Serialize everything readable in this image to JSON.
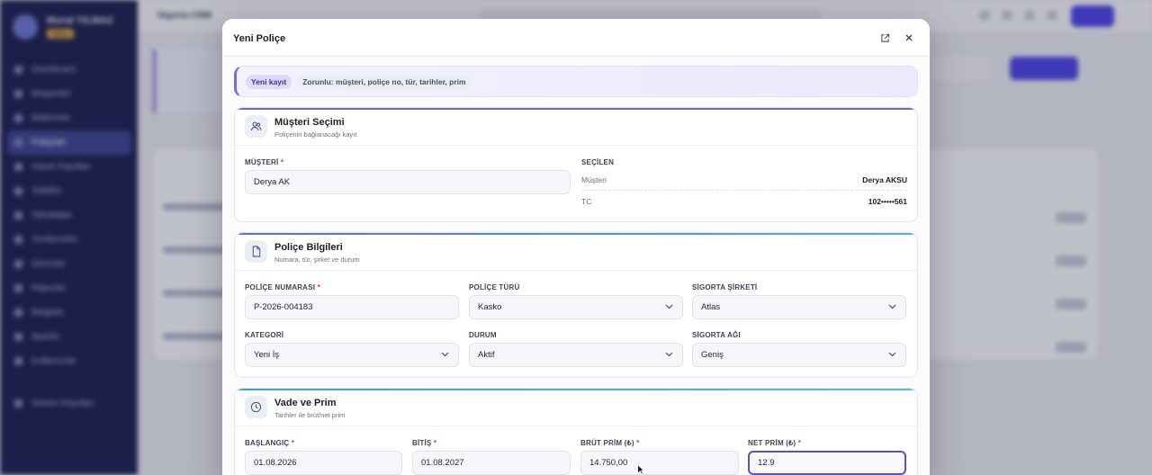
{
  "background": {
    "user_name": "Murat YILMAZ",
    "user_badge": "Ajans",
    "topbar_title": "Sigorta CRM",
    "nav": [
      "Dashboard",
      "Müşteriler",
      "Bildirimler",
      "Poliçeler",
      "Hasar Kayıtları",
      "Teklifler",
      "Tahsilatlar",
      "Yenilemeler",
      "Görevler",
      "Raporlar",
      "Belgeler",
      "Ayarlar",
      "Kullanıcılar",
      "Sistem Kayıtları"
    ],
    "active_nav": "Poliçeler",
    "page_title": "Poliçeler",
    "btn_secondary": "Dışa aktar",
    "btn_primary": "Yeni Poliçe",
    "topbar_new": "Yeni",
    "rows": [
      "P-2026-004178",
      "P-2026-004179",
      "P-2026-004180",
      "P-2026-004181"
    ]
  },
  "modal": {
    "title": "Yeni Poliçe",
    "banner": {
      "badge": "Yeni kayıt",
      "note": "Zorunlu: müşteri, poliçe no, tür, tarihler, prim"
    },
    "customer_section": {
      "title": "Müşteri Seçimi",
      "subtitle": "Poliçenin bağlanacağı kayıt",
      "customer_label": "MÜŞTERİ",
      "customer_value": "Derya AK",
      "selected_label": "SEÇİLEN",
      "selected_rows": [
        {
          "key": "Müşteri",
          "value": "Derya AKSU"
        },
        {
          "key": "TC",
          "value": "102•••••561"
        }
      ]
    },
    "policy_section": {
      "title": "Poliçe Bilgileri",
      "subtitle": "Numara, tür, şirket ve durum",
      "policy_no_label": "POLİÇE NUMARASI",
      "policy_no_value": "P-2026-004183",
      "policy_type_label": "POLİÇE TÜRÜ",
      "policy_type_value": "Kasko",
      "company_label": "SİGORTA ŞİRKETİ",
      "company_value": "Atlas",
      "category_label": "KATEGORİ",
      "category_value": "Yeni İş",
      "status_label": "DURUM",
      "status_value": "Aktif",
      "network_label": "SİGORTA AĞI",
      "network_value": "Geniş"
    },
    "term_section": {
      "title": "Vade ve Prim",
      "subtitle": "Tarihler ile brüt/net prim",
      "start_label": "BAŞLANGIÇ",
      "start_value": "01.08.2026",
      "end_label": "BİTİŞ",
      "end_value": "01.08.2027",
      "gross_label": "BRÜT PRİM (₺)",
      "gross_value": "14.750,00",
      "net_label": "NET PRİM (₺)",
      "net_value": "12.9"
    },
    "required_mark": "*"
  },
  "colors": {
    "accent": "#5a50c9",
    "section1_bar": "#7b5fd6",
    "section2_bar": "#4f8fe0",
    "section3_bar": "#38a3c6",
    "required": "#e0345a"
  },
  "icons": [
    "external-link-icon",
    "close-icon",
    "users-icon",
    "document-icon",
    "clock-icon",
    "chevron-down-icon",
    "mouse-cursor-icon"
  ]
}
